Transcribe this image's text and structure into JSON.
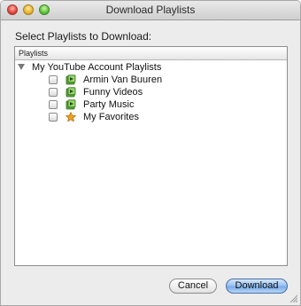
{
  "window": {
    "title": "Download Playlists"
  },
  "dialog": {
    "prompt": "Select Playlists to Download:",
    "tree_header": "Playlists",
    "root_label": "My YouTube Account Playlists",
    "items": [
      {
        "label": "Armin Van Buuren",
        "icon": "playlist-icon",
        "checked": false
      },
      {
        "label": "Funny Videos",
        "icon": "playlist-icon",
        "checked": false
      },
      {
        "label": "Party Music",
        "icon": "playlist-icon",
        "checked": false
      },
      {
        "label": "My Favorites",
        "icon": "star-icon",
        "checked": false
      }
    ]
  },
  "buttons": {
    "cancel_label": "Cancel",
    "download_label": "Download"
  },
  "colors": {
    "window_bg": "#ececec",
    "default_button": "#7aabea",
    "star": "#f0a020",
    "playlist_icon": "#5aa83a"
  }
}
